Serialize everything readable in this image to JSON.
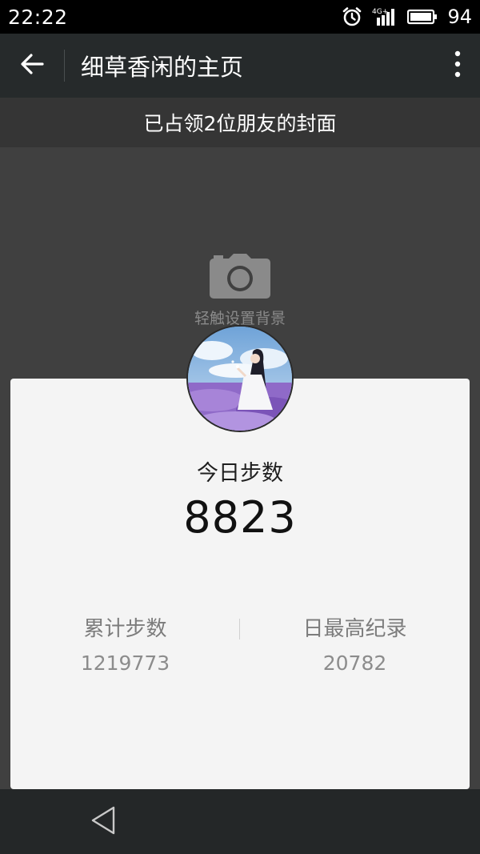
{
  "status_bar": {
    "time": "22:22",
    "network": "4G+",
    "battery": "94",
    "icons": [
      "alarm-icon",
      "signal-icon",
      "battery-icon"
    ]
  },
  "app_bar": {
    "title": "细草香闲的主页",
    "back_icon": "back-arrow-icon",
    "more_icon": "more-vertical-icon"
  },
  "banner": {
    "text": "已占领2位朋友的封面"
  },
  "cover": {
    "camera_icon": "camera-icon",
    "label": "轻触设置背景"
  },
  "card": {
    "today_label": "今日步数",
    "today_value": "8823",
    "total_label": "累计步数",
    "total_value": "1219773",
    "record_label": "日最高纪录",
    "record_value": "20782"
  },
  "nav_bar": {
    "back_icon": "nav-back-triangle-icon"
  },
  "colors": {
    "status_bg": "#000000",
    "app_bar_bg": "#262a2b",
    "banner_bg": "#353535",
    "cover_bg": "#404040",
    "card_bg": "#f4f4f4",
    "nav_bg": "#242728"
  }
}
